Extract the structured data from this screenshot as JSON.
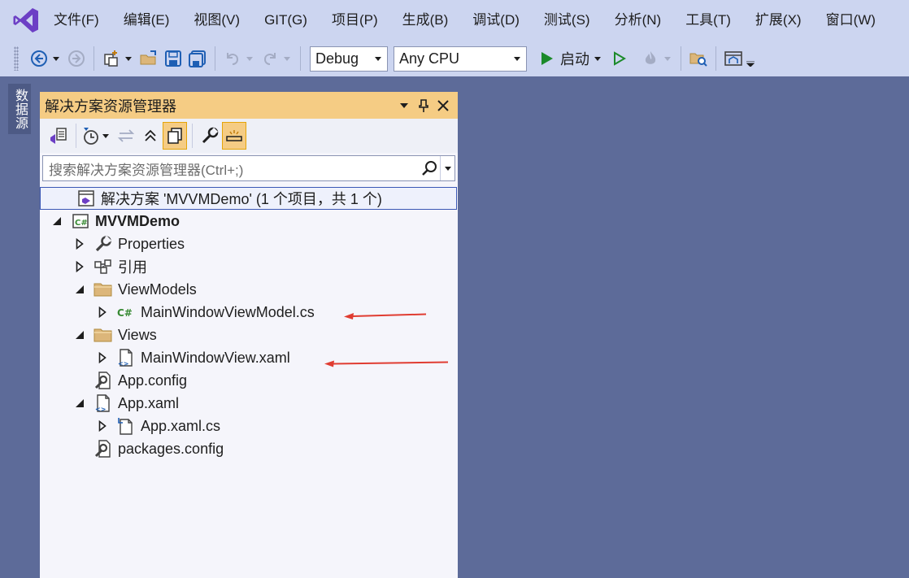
{
  "menubar": {
    "logo_icon": "visual-studio-logo-icon",
    "items": [
      "文件(F)",
      "编辑(E)",
      "视图(V)",
      "GIT(G)",
      "项目(P)",
      "生成(B)",
      "调试(D)",
      "测试(S)",
      "分析(N)",
      "工具(T)",
      "扩展(X)",
      "窗口(W)"
    ]
  },
  "toolbar": {
    "configuration": "Debug",
    "platform": "Any CPU",
    "start_label": "启动",
    "icons": [
      "back-icon",
      "forward-icon",
      "new-project-icon",
      "open-folder-icon",
      "save-icon",
      "save-all-icon",
      "undo-icon",
      "redo-icon",
      "start-icon",
      "start-without-debugging-icon",
      "hot-reload-icon",
      "find-in-files-icon",
      "browser-link-icon"
    ]
  },
  "side_tab": {
    "label": "数据源"
  },
  "solution_explorer": {
    "title": "解决方案资源管理器",
    "title_controls": [
      "dropdown-icon",
      "pin-icon",
      "close-icon"
    ],
    "toolbar_icons": [
      "switch-views-icon",
      "pending-changes-filter-icon",
      "sync-icon",
      "collapse-all-icon",
      "show-all-files-icon",
      "properties-icon",
      "preview-selected-icon"
    ],
    "search_placeholder": "搜索解决方案资源管理器(Ctrl+;)",
    "tree": [
      {
        "label": "解决方案 'MVVMDemo' (1 个项目，共 1 个)",
        "icon": "solution-icon",
        "expander": "none",
        "selected": true
      },
      {
        "label": "MVVMDemo",
        "icon": "csharp-project-icon",
        "expander": "expanded",
        "bold": true
      },
      {
        "label": "Properties",
        "icon": "wrench-icon",
        "expander": "collapsed"
      },
      {
        "label": "引用",
        "icon": "references-icon",
        "expander": "collapsed"
      },
      {
        "label": "ViewModels",
        "icon": "folder-icon",
        "expander": "expanded"
      },
      {
        "label": "MainWindowViewModel.cs",
        "icon": "csharp-file-icon",
        "expander": "collapsed",
        "annotated": true
      },
      {
        "label": "Views",
        "icon": "folder-icon",
        "expander": "expanded"
      },
      {
        "label": "MainWindowView.xaml",
        "icon": "xaml-file-icon",
        "expander": "collapsed",
        "annotated": true
      },
      {
        "label": "App.config",
        "icon": "config-file-icon",
        "expander": "none"
      },
      {
        "label": "App.xaml",
        "icon": "xaml-file-icon",
        "expander": "expanded"
      },
      {
        "label": "App.xaml.cs",
        "icon": "code-behind-file-icon",
        "expander": "collapsed"
      },
      {
        "label": "packages.config",
        "icon": "config-file-icon",
        "expander": "none"
      }
    ]
  },
  "colors": {
    "background": "#5d6b99",
    "chrome": "#ccd5f0",
    "panel_title": "#f5cc84",
    "annotation_arrow": "#e03c31"
  }
}
